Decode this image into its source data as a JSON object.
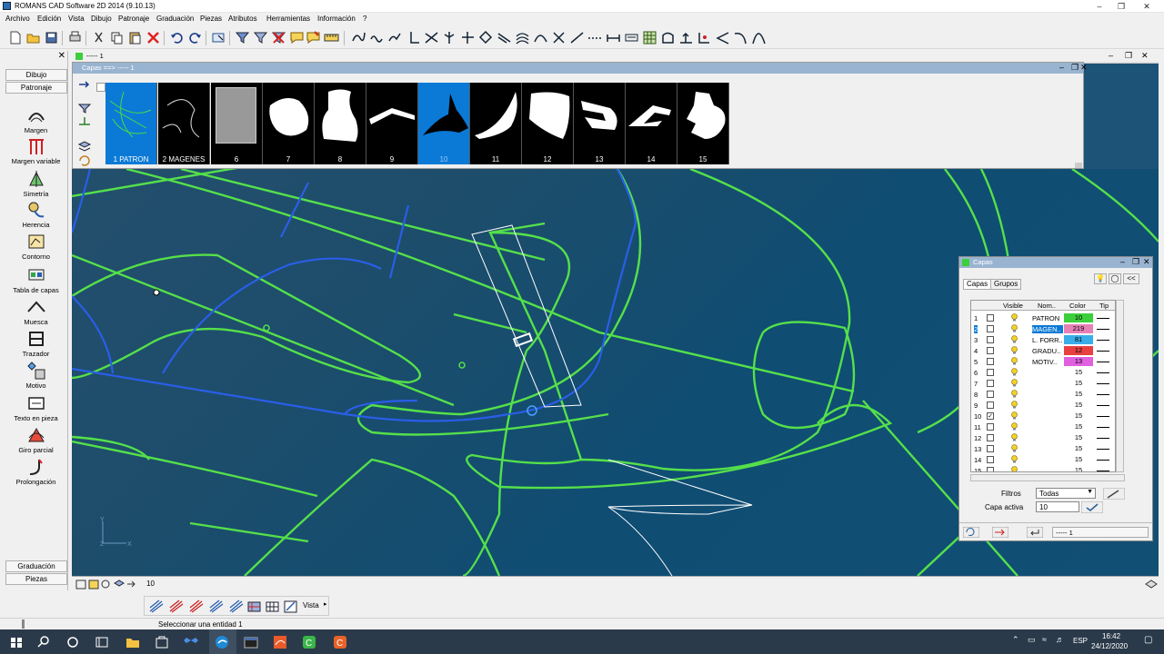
{
  "window": {
    "title": "ROMANS CAD Software 2D 2014 (9.10.13)"
  },
  "menu": [
    "Archivo",
    "Edición",
    "Vista",
    "Dibujo",
    "Patronaje",
    "Graduación",
    "Piezas",
    "Atributos",
    "Herramientas",
    "Información",
    "?"
  ],
  "left_panel": {
    "top_tabs": [
      "Dibujo",
      "Patronaje"
    ],
    "tools": [
      "Margen",
      "Margen variable",
      "Simetría",
      "Herencia",
      "Contorno",
      "Tabla de capas",
      "Muesca",
      "Trazador",
      "Motivo",
      "Texto en pieza",
      "Giro parcial",
      "Prolongación"
    ],
    "bottom_tabs": [
      "Graduación",
      "Piezas"
    ]
  },
  "doc_window": {
    "title": "----- 1"
  },
  "layer_strip": {
    "title": "Capas ==> ----- 1",
    "thumbs": [
      "1  PATRON",
      "2  MAGENES",
      "6",
      "7",
      "8",
      "9",
      "10",
      "11",
      "12",
      "13",
      "14",
      "15"
    ],
    "selected": "10"
  },
  "capas_panel": {
    "title": "Capas",
    "tabs": [
      "Capas",
      "Grupos"
    ],
    "headers": [
      "Visible",
      "Nom..",
      "Color",
      "Tip"
    ],
    "rows": [
      {
        "n": "1",
        "check": "",
        "name": "PATRON",
        "color": "10",
        "hex": "#3ccf3c"
      },
      {
        "n": "2",
        "check": "",
        "name": "MAGEN..",
        "color": "219",
        "hex": "#e880b8"
      },
      {
        "n": "3",
        "check": "",
        "name": "L. FORR..",
        "color": "81",
        "hex": "#3aaee8"
      },
      {
        "n": "4",
        "check": "",
        "name": "GRADU..",
        "color": "12",
        "hex": "#e84040"
      },
      {
        "n": "5",
        "check": "",
        "name": "MOTIV..",
        "color": "13",
        "hex": "#e060e0"
      },
      {
        "n": "6",
        "check": "",
        "name": "",
        "color": "15",
        "hex": "#ffffff"
      },
      {
        "n": "7",
        "check": "",
        "name": "",
        "color": "15",
        "hex": "#ffffff"
      },
      {
        "n": "8",
        "check": "",
        "name": "",
        "color": "15",
        "hex": "#ffffff"
      },
      {
        "n": "9",
        "check": "",
        "name": "",
        "color": "15",
        "hex": "#ffffff"
      },
      {
        "n": "10",
        "check": "✓",
        "name": "",
        "color": "15",
        "hex": "#ffffff"
      },
      {
        "n": "11",
        "check": "",
        "name": "",
        "color": "15",
        "hex": "#ffffff"
      },
      {
        "n": "12",
        "check": "",
        "name": "",
        "color": "15",
        "hex": "#ffffff"
      },
      {
        "n": "13",
        "check": "",
        "name": "",
        "color": "15",
        "hex": "#ffffff"
      },
      {
        "n": "14",
        "check": "",
        "name": "",
        "color": "15",
        "hex": "#ffffff"
      },
      {
        "n": "15",
        "check": "",
        "name": "",
        "color": "15",
        "hex": "#ffffff"
      }
    ],
    "filter_label": "Filtros",
    "filter_value": "Todas",
    "active_label": "Capa activa",
    "active_value": "10",
    "footer_field": "----- 1"
  },
  "bottom_bar": {
    "value": "10"
  },
  "vista_bar": {
    "label": "Vista"
  },
  "status": {
    "message": "Seleccionar una entidad 1"
  },
  "taskbar": {
    "lang": "ESP",
    "time": "16:42",
    "date": "24/12/2020"
  },
  "canvas": {
    "axis_y": "Y",
    "axis_z": "Z",
    "axis_x": "X"
  },
  "colors": {
    "pattern_line": "#55e04a",
    "blue_line": "#2a5ee8",
    "canvas": "#1a4d6e",
    "selection": "#0a7ad6"
  }
}
